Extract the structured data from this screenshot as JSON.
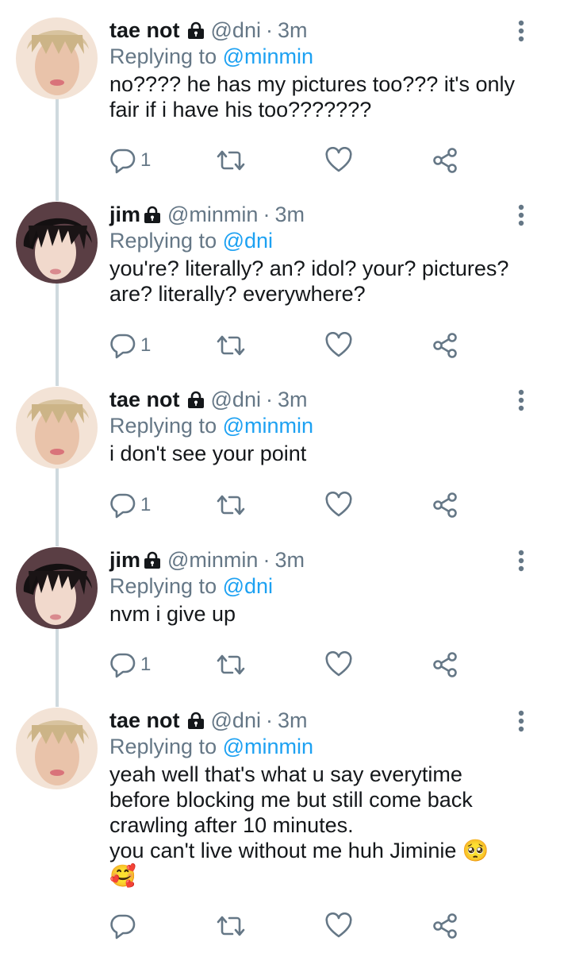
{
  "tweets": [
    {
      "name": "tae not",
      "handle": "@dni",
      "dot": "·",
      "time": "3m",
      "replying_prefix": "Replying to",
      "replying_to": "@minmin",
      "lines": [
        "no???? he has my pictures too??? it's only",
        "fair if i have his too???????"
      ],
      "reply_count": "1"
    },
    {
      "name": "jim",
      "handle": "@minmin",
      "dot": "·",
      "time": "3m",
      "replying_prefix": "Replying to",
      "replying_to": "@dni",
      "lines": [
        "you're? literally? an? idol? your? pictures?",
        "are? literally? everywhere?"
      ],
      "reply_count": "1"
    },
    {
      "name": "tae not",
      "handle": "@dni",
      "dot": "·",
      "time": "3m",
      "replying_prefix": "Replying to",
      "replying_to": "@minmin",
      "lines": [
        "i don't see your point"
      ],
      "reply_count": "1"
    },
    {
      "name": "jim",
      "handle": "@minmin",
      "dot": "·",
      "time": "3m",
      "replying_prefix": "Replying to",
      "replying_to": "@dni",
      "lines": [
        "nvm i give up"
      ],
      "reply_count": "1"
    },
    {
      "name": "tae not",
      "handle": "@dni",
      "dot": "·",
      "time": "3m",
      "replying_prefix": "Replying to",
      "replying_to": "@minmin",
      "lines": [
        "yeah well that's what u say everytime",
        "before blocking me but still come back",
        "crawling after 10 minutes.",
        "you can't live without me huh Jiminie 🥺",
        "🥰"
      ],
      "reply_count": ""
    }
  ],
  "icons": {
    "lock": "lock-icon",
    "menu": "more-vertical-icon",
    "reply": "reply-bubble-icon",
    "retweet": "retweet-icon",
    "like": "heart-icon",
    "share": "share-icon"
  },
  "colors": {
    "text": "#14171a",
    "muted": "#657786",
    "link": "#1da1f2",
    "thread_line": "#cfd9de"
  }
}
